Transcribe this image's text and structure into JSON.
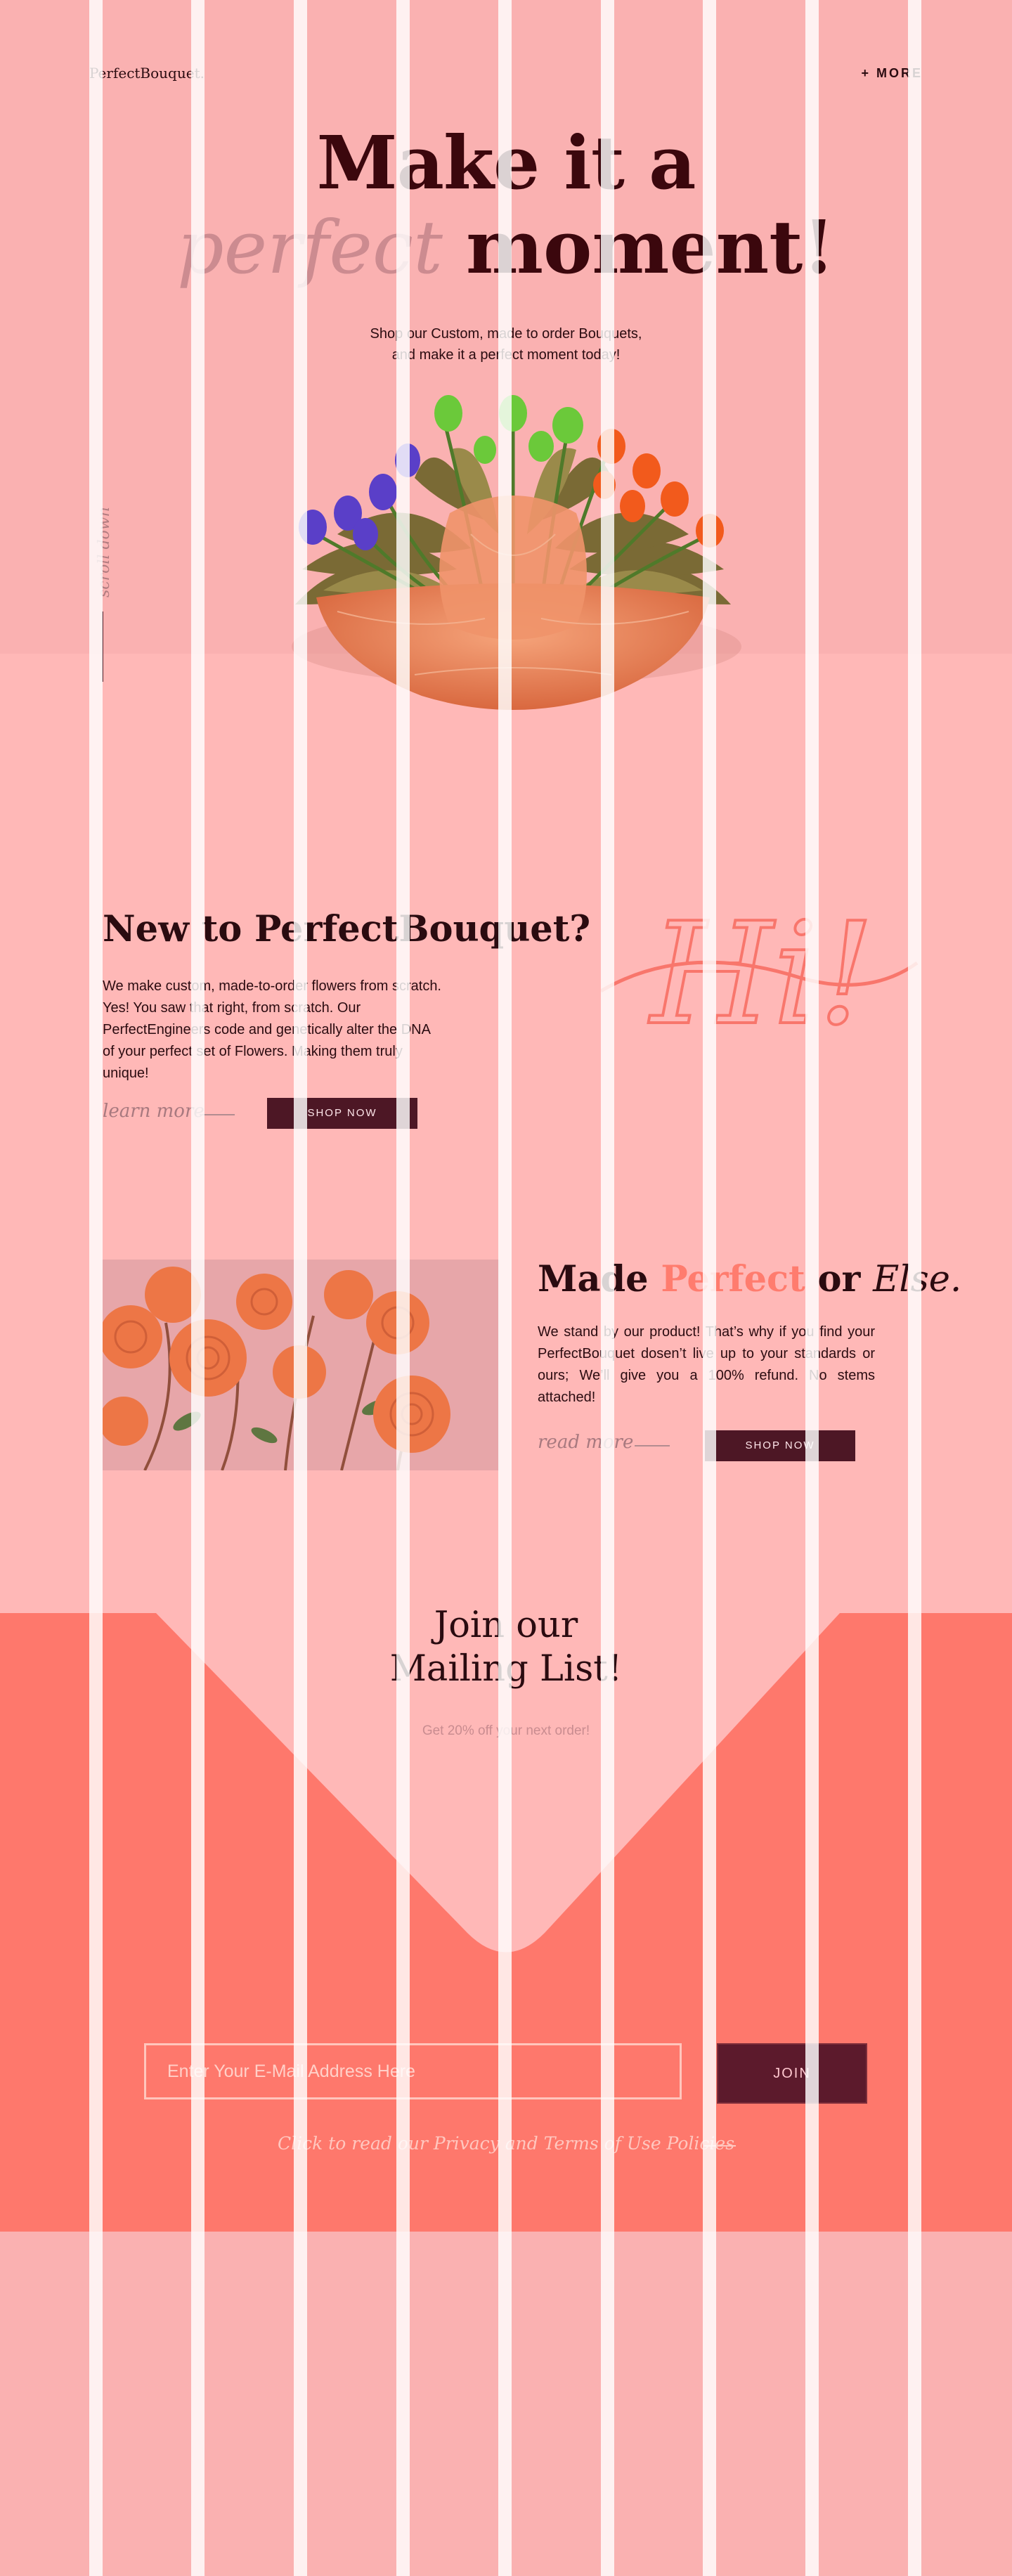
{
  "header": {
    "logo": "PerfectBouquet.",
    "more_label": "+ MORE"
  },
  "hero": {
    "title_line1": "Make it a",
    "title_word_italic": "perfect",
    "title_word_bold": "moment!",
    "subtitle_line1": "Shop our Custom, made to order Bouquets,",
    "subtitle_line2": "and make it a perfect moment today!",
    "scroll_label": "scroll down"
  },
  "intro": {
    "heading": "New to PerfectBouquet?",
    "body": "We make custom, made-to-order flowers from scratch. Yes! You saw that right, from scratch. Our PerfectEngineers code and genetically alter the DNA of your perfect set of Flowers. Making them truly unique!",
    "learn_more": "learn more",
    "shop_now": "SHOP NOW",
    "script_text": "Hi!"
  },
  "promise": {
    "heading_part1": "Made",
    "heading_accent": "Perfect",
    "heading_part2": "or",
    "heading_italic": "Else.",
    "body": "We stand by our product! That’s why if you find your PerfectBouquet dosen’t live up to your standards or ours; We’ll give you a 100% refund. No stems attached!",
    "read_more": "read more",
    "shop_now": "SHOP NOW"
  },
  "mailing": {
    "heading_line1": "Join our",
    "heading_line2": "Mailing List!",
    "subtitle": "Get 20% off your next order!",
    "email_placeholder": "Enter Your E-Mail Address Here",
    "join_label": "JOIN",
    "policy_text": "Click to read our Privacy and Terms of Use Policies"
  },
  "colors": {
    "hero_bg": "#fab1b1",
    "section_bg": "#ffb8b7",
    "mailing_bg": "#fe786c",
    "dark_text": "#2a0b10",
    "button_bg": "#4d1725",
    "accent": "#ff7c6e"
  }
}
